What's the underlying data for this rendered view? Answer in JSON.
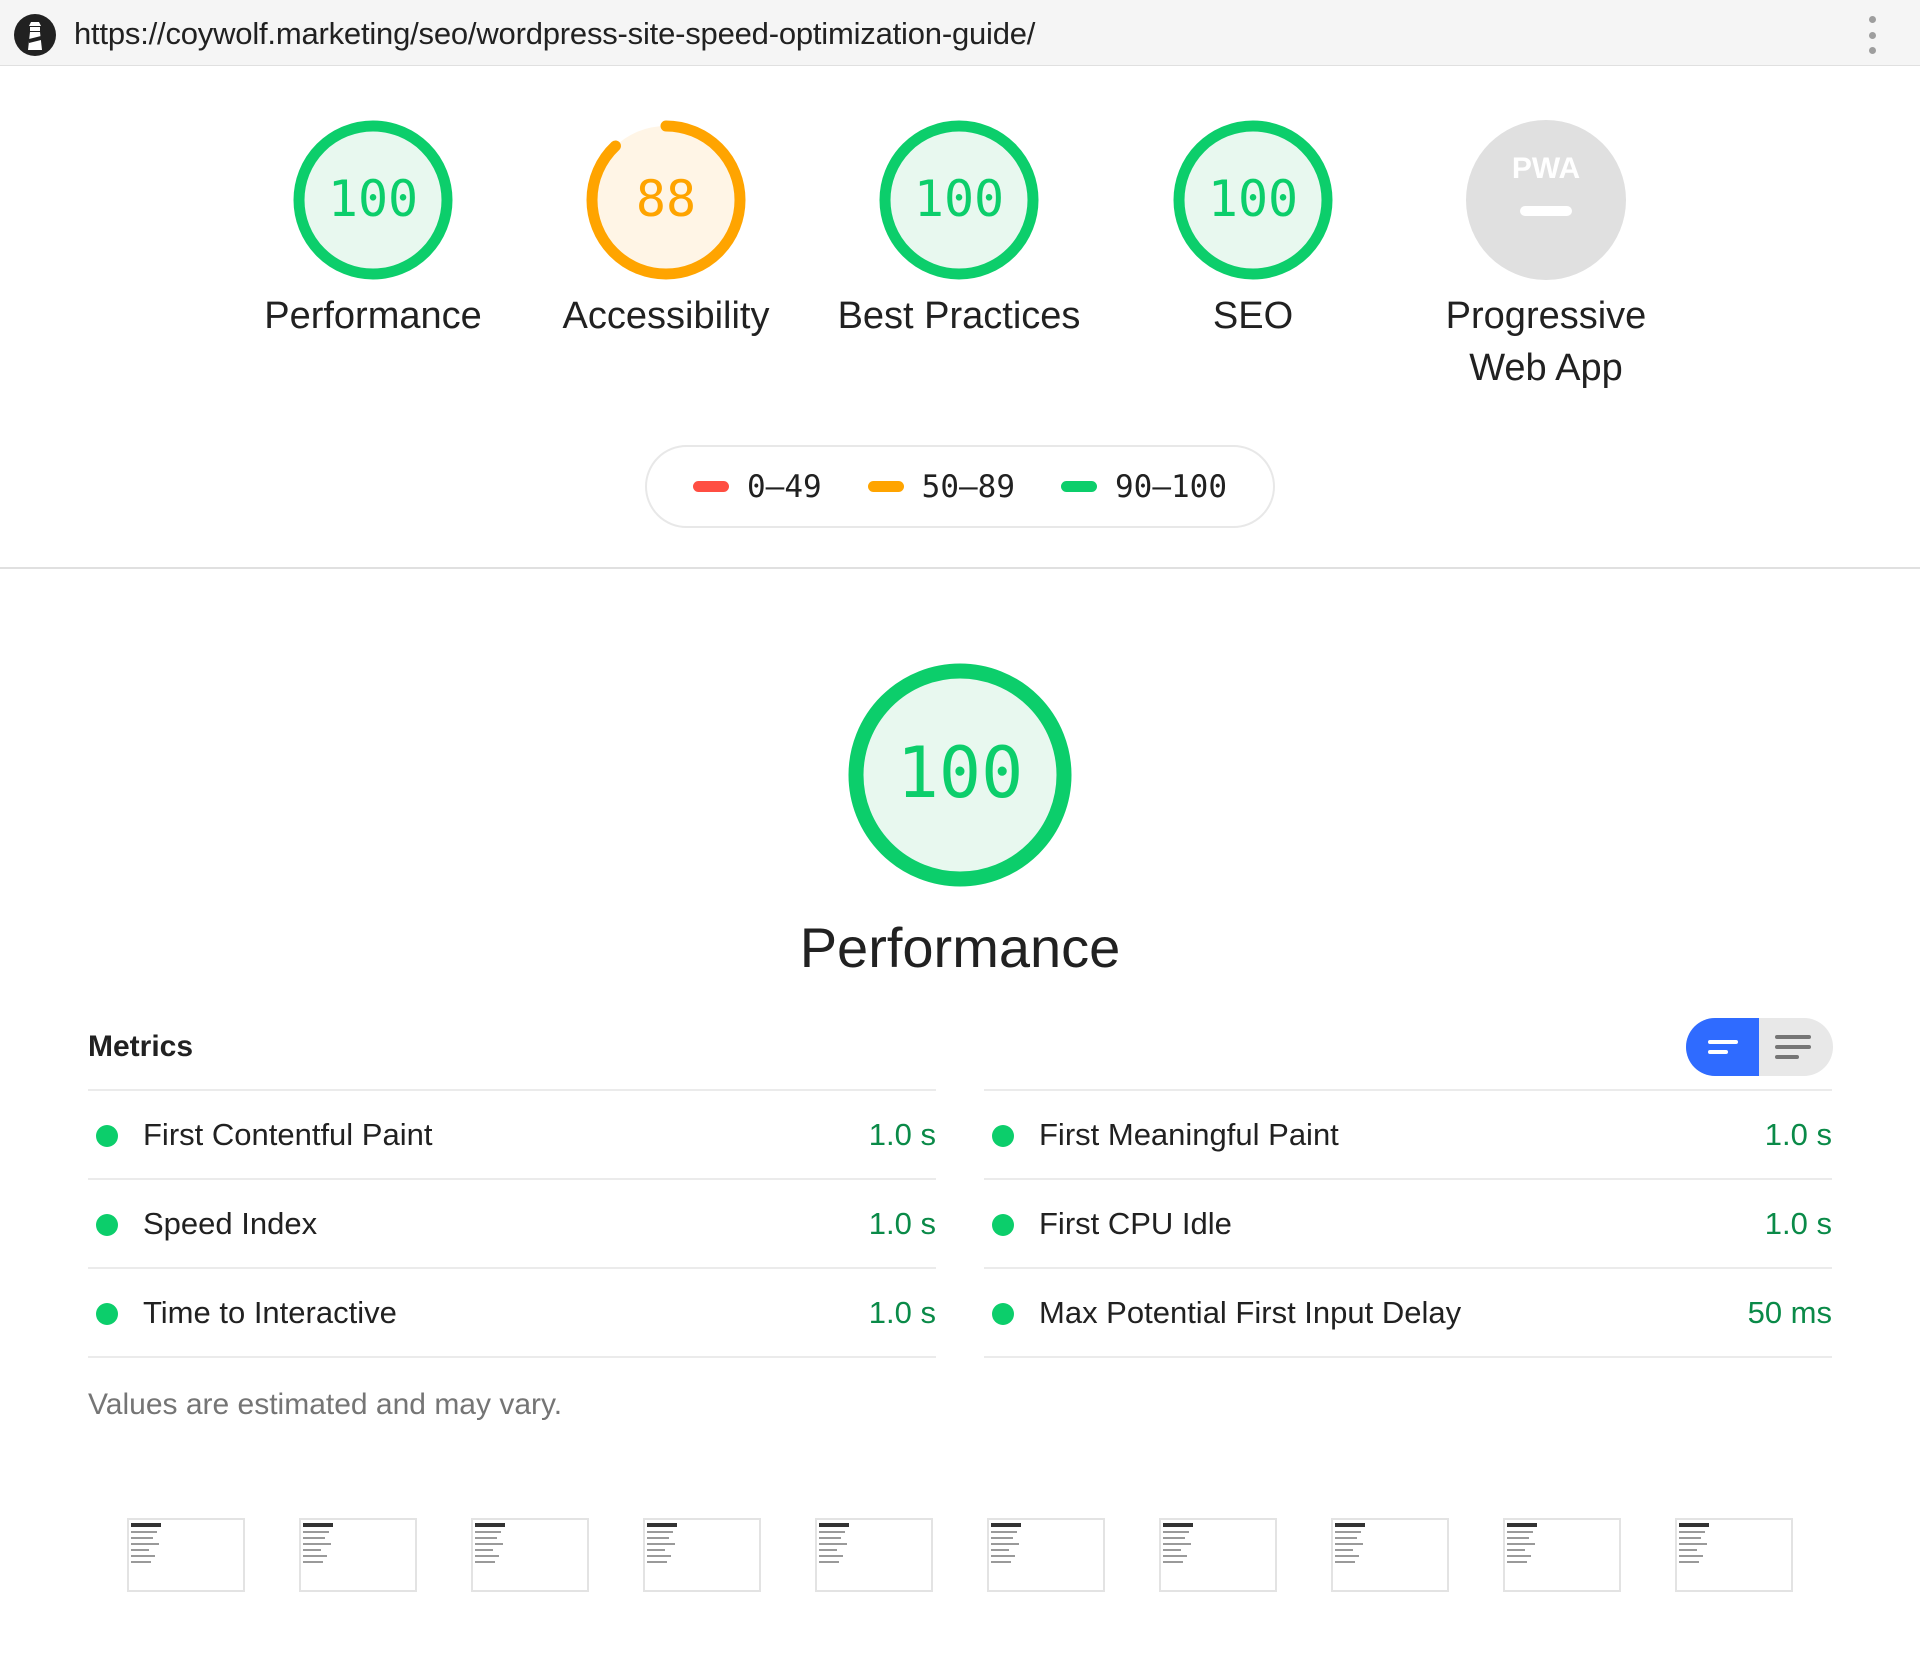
{
  "url": "https://coywolf.marketing/seo/wordpress-site-speed-optimization-guide/",
  "colors": {
    "pass": "#0cce6b",
    "average": "#ffa400",
    "fail": "#ff4e42",
    "na": "#e0e0e0",
    "accent_blue": "#2f6bff"
  },
  "categories": [
    {
      "label": "Performance",
      "score": "100",
      "score_fraction": 1.0,
      "rating": "pass"
    },
    {
      "label": "Accessibility",
      "score": "88",
      "score_fraction": 0.88,
      "rating": "average"
    },
    {
      "label": "Best Practices",
      "score": "100",
      "score_fraction": 1.0,
      "rating": "pass"
    },
    {
      "label": "SEO",
      "score": "100",
      "score_fraction": 1.0,
      "rating": "pass"
    },
    {
      "label_line1": "Progressive",
      "label_line2": "Web App",
      "badge": "PWA",
      "rating": "na"
    }
  ],
  "legend": [
    {
      "range": "0–49",
      "rating": "fail"
    },
    {
      "range": "50–89",
      "rating": "average"
    },
    {
      "range": "90–100",
      "rating": "pass"
    }
  ],
  "performance": {
    "title": "Performance",
    "score": "100",
    "score_fraction": 1.0
  },
  "metrics": {
    "title": "Metrics",
    "left": [
      {
        "name": "First Contentful Paint",
        "value": "1.0 s"
      },
      {
        "name": "Speed Index",
        "value": "1.0 s"
      },
      {
        "name": "Time to Interactive",
        "value": "1.0 s"
      }
    ],
    "right": [
      {
        "name": "First Meaningful Paint",
        "value": "1.0 s"
      },
      {
        "name": "First CPU Idle",
        "value": "1.0 s"
      },
      {
        "name": "Max Potential First Input Delay",
        "value": "50 ms"
      }
    ],
    "note": "Values are estimated and may vary."
  },
  "filmstrip_frame_count": 10
}
